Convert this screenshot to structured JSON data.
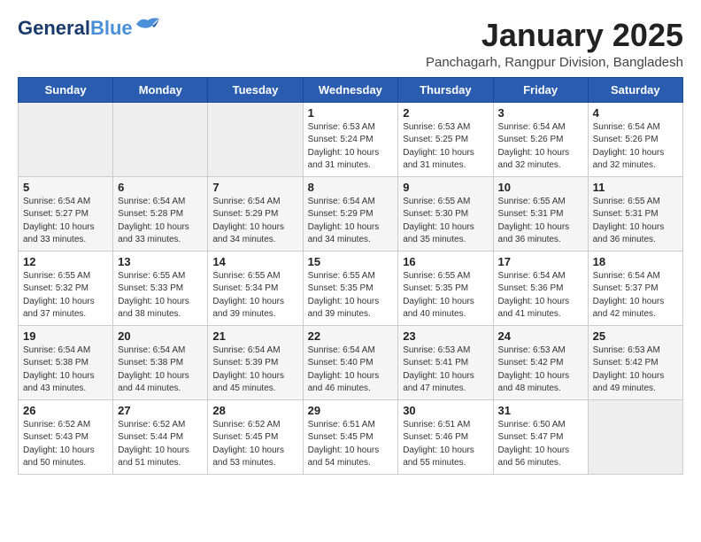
{
  "logo": {
    "line1": "General",
    "line2": "Blue"
  },
  "header": {
    "title": "January 2025",
    "subtitle": "Panchagarh, Rangpur Division, Bangladesh"
  },
  "days_of_week": [
    "Sunday",
    "Monday",
    "Tuesday",
    "Wednesday",
    "Thursday",
    "Friday",
    "Saturday"
  ],
  "weeks": [
    [
      {
        "day": "",
        "empty": true
      },
      {
        "day": "",
        "empty": true
      },
      {
        "day": "",
        "empty": true
      },
      {
        "day": "1",
        "sunrise": "6:53 AM",
        "sunset": "5:24 PM",
        "daylight": "10 hours and 31 minutes."
      },
      {
        "day": "2",
        "sunrise": "6:53 AM",
        "sunset": "5:25 PM",
        "daylight": "10 hours and 31 minutes."
      },
      {
        "day": "3",
        "sunrise": "6:54 AM",
        "sunset": "5:26 PM",
        "daylight": "10 hours and 32 minutes."
      },
      {
        "day": "4",
        "sunrise": "6:54 AM",
        "sunset": "5:26 PM",
        "daylight": "10 hours and 32 minutes."
      }
    ],
    [
      {
        "day": "5",
        "sunrise": "6:54 AM",
        "sunset": "5:27 PM",
        "daylight": "10 hours and 33 minutes."
      },
      {
        "day": "6",
        "sunrise": "6:54 AM",
        "sunset": "5:28 PM",
        "daylight": "10 hours and 33 minutes."
      },
      {
        "day": "7",
        "sunrise": "6:54 AM",
        "sunset": "5:29 PM",
        "daylight": "10 hours and 34 minutes."
      },
      {
        "day": "8",
        "sunrise": "6:54 AM",
        "sunset": "5:29 PM",
        "daylight": "10 hours and 34 minutes."
      },
      {
        "day": "9",
        "sunrise": "6:55 AM",
        "sunset": "5:30 PM",
        "daylight": "10 hours and 35 minutes."
      },
      {
        "day": "10",
        "sunrise": "6:55 AM",
        "sunset": "5:31 PM",
        "daylight": "10 hours and 36 minutes."
      },
      {
        "day": "11",
        "sunrise": "6:55 AM",
        "sunset": "5:31 PM",
        "daylight": "10 hours and 36 minutes."
      }
    ],
    [
      {
        "day": "12",
        "sunrise": "6:55 AM",
        "sunset": "5:32 PM",
        "daylight": "10 hours and 37 minutes."
      },
      {
        "day": "13",
        "sunrise": "6:55 AM",
        "sunset": "5:33 PM",
        "daylight": "10 hours and 38 minutes."
      },
      {
        "day": "14",
        "sunrise": "6:55 AM",
        "sunset": "5:34 PM",
        "daylight": "10 hours and 39 minutes."
      },
      {
        "day": "15",
        "sunrise": "6:55 AM",
        "sunset": "5:35 PM",
        "daylight": "10 hours and 39 minutes."
      },
      {
        "day": "16",
        "sunrise": "6:55 AM",
        "sunset": "5:35 PM",
        "daylight": "10 hours and 40 minutes."
      },
      {
        "day": "17",
        "sunrise": "6:54 AM",
        "sunset": "5:36 PM",
        "daylight": "10 hours and 41 minutes."
      },
      {
        "day": "18",
        "sunrise": "6:54 AM",
        "sunset": "5:37 PM",
        "daylight": "10 hours and 42 minutes."
      }
    ],
    [
      {
        "day": "19",
        "sunrise": "6:54 AM",
        "sunset": "5:38 PM",
        "daylight": "10 hours and 43 minutes."
      },
      {
        "day": "20",
        "sunrise": "6:54 AM",
        "sunset": "5:38 PM",
        "daylight": "10 hours and 44 minutes."
      },
      {
        "day": "21",
        "sunrise": "6:54 AM",
        "sunset": "5:39 PM",
        "daylight": "10 hours and 45 minutes."
      },
      {
        "day": "22",
        "sunrise": "6:54 AM",
        "sunset": "5:40 PM",
        "daylight": "10 hours and 46 minutes."
      },
      {
        "day": "23",
        "sunrise": "6:53 AM",
        "sunset": "5:41 PM",
        "daylight": "10 hours and 47 minutes."
      },
      {
        "day": "24",
        "sunrise": "6:53 AM",
        "sunset": "5:42 PM",
        "daylight": "10 hours and 48 minutes."
      },
      {
        "day": "25",
        "sunrise": "6:53 AM",
        "sunset": "5:42 PM",
        "daylight": "10 hours and 49 minutes."
      }
    ],
    [
      {
        "day": "26",
        "sunrise": "6:52 AM",
        "sunset": "5:43 PM",
        "daylight": "10 hours and 50 minutes."
      },
      {
        "day": "27",
        "sunrise": "6:52 AM",
        "sunset": "5:44 PM",
        "daylight": "10 hours and 51 minutes."
      },
      {
        "day": "28",
        "sunrise": "6:52 AM",
        "sunset": "5:45 PM",
        "daylight": "10 hours and 53 minutes."
      },
      {
        "day": "29",
        "sunrise": "6:51 AM",
        "sunset": "5:45 PM",
        "daylight": "10 hours and 54 minutes."
      },
      {
        "day": "30",
        "sunrise": "6:51 AM",
        "sunset": "5:46 PM",
        "daylight": "10 hours and 55 minutes."
      },
      {
        "day": "31",
        "sunrise": "6:50 AM",
        "sunset": "5:47 PM",
        "daylight": "10 hours and 56 minutes."
      },
      {
        "day": "",
        "empty": true
      }
    ]
  ],
  "labels": {
    "sunrise": "Sunrise:",
    "sunset": "Sunset:",
    "daylight": "Daylight:"
  }
}
